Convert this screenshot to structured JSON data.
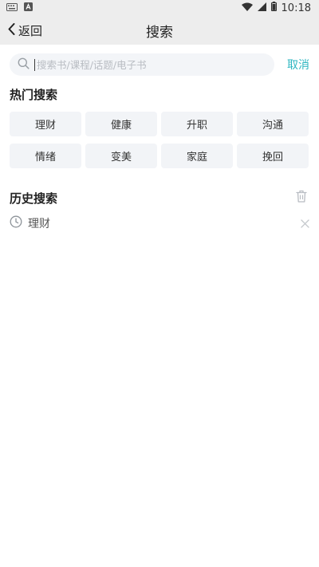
{
  "status_bar": {
    "time": "10:18"
  },
  "nav": {
    "back_label": "返回",
    "title": "搜索"
  },
  "search": {
    "placeholder": "搜索书/课程/话题/电子书",
    "value": "",
    "cancel_label": "取消"
  },
  "hot": {
    "title": "热门搜索",
    "tags": [
      "理财",
      "健康",
      "升职",
      "沟通",
      "情绪",
      "变美",
      "家庭",
      "挽回"
    ]
  },
  "history": {
    "title": "历史搜索",
    "items": [
      "理财"
    ]
  },
  "colors": {
    "accent": "#2db6c1",
    "tag_bg": "#f2f4f7",
    "bar_bg": "#ededed"
  }
}
